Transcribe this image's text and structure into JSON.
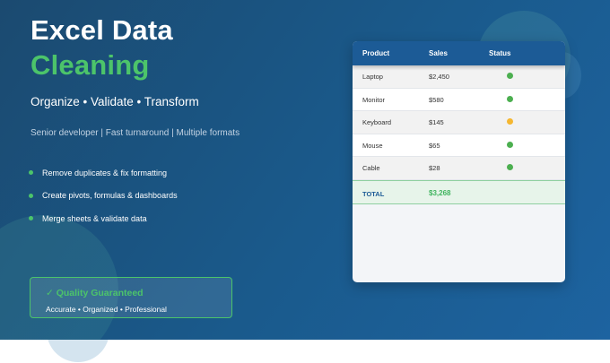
{
  "hero": {
    "title_line1": "Excel Data",
    "title_line2": "Cleaning",
    "subtitle": "Organize • Validate • Transform",
    "tagline": "Senior developer | Fast turnaround | Multiple formats"
  },
  "features": [
    "Remove duplicates & fix formatting",
    "Create pivots, formulas & dashboards",
    "Merge sheets & validate data"
  ],
  "badge": {
    "title": "✓ Quality Guaranteed",
    "subtitle": "Accurate • Organized • Professional"
  },
  "table": {
    "headers": {
      "product": "Product",
      "sales": "Sales",
      "status": "Status"
    },
    "rows": [
      {
        "product": "Laptop",
        "sales": "$2,450",
        "status_color": "#4caf50"
      },
      {
        "product": "Monitor",
        "sales": "$580",
        "status_color": "#4caf50"
      },
      {
        "product": "Keyboard",
        "sales": "$145",
        "status_color": "#f5b731"
      },
      {
        "product": "Mouse",
        "sales": "$65",
        "status_color": "#4caf50"
      },
      {
        "product": "Cable",
        "sales": "$28",
        "status_color": "#4caf50"
      }
    ],
    "total_label": "TOTAL",
    "total_value": "$3,268"
  },
  "colors": {
    "accent_green": "#4cc46a",
    "header_blue": "#1c5b96",
    "status_ok": "#4caf50",
    "status_warn": "#f5b731"
  }
}
